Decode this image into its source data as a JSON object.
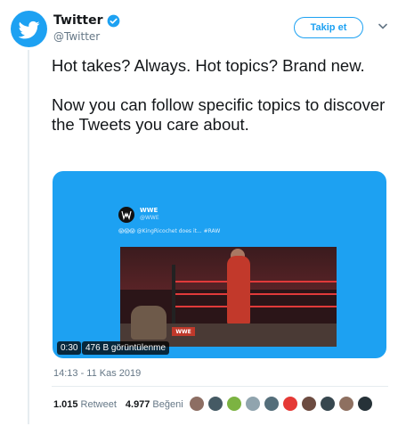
{
  "tweet": {
    "display_name": "Twitter",
    "handle": "@Twitter",
    "follow_label": "Takip et",
    "text_line1": "Hot takes? Always. Hot topics? Brand new.",
    "text_line2": "Now you can follow specific topics to discover the Tweets you care about.",
    "timestamp": "14:13 - 11 Kas 2019",
    "retweets_count": "1.015",
    "retweets_label": "Retweet",
    "likes_count": "4.977",
    "likes_label": "Beğeni"
  },
  "media": {
    "video_time": "0:30",
    "views_label": "476 B görüntülenme",
    "embedded_name": "WWE",
    "embedded_handle": "@WWE",
    "embedded_text": "😱😱😱 @KingRicochet does it... #RAW"
  },
  "colors": {
    "accent": "#1da1f2",
    "text_primary": "#14171a",
    "text_secondary": "#657786"
  },
  "icons": {
    "avatar": "twitter-bird-icon",
    "verified": "verified-badge-icon",
    "caret": "chevron-down-icon"
  },
  "likers": [
    "#8d6e63",
    "#455a64",
    "#7cb342",
    "#90a4ae",
    "#546e7a",
    "#e53935",
    "#6d4c41",
    "#37474f",
    "#8e7060",
    "#263238"
  ]
}
